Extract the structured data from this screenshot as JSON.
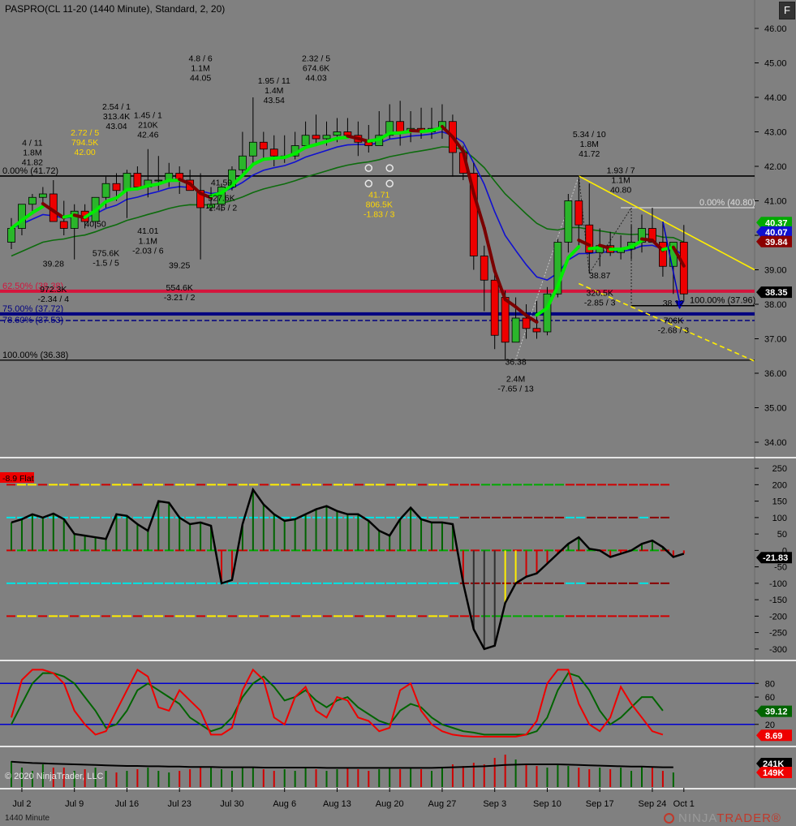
{
  "header": {
    "title": "PASPRO(CL 11-20 (1440 Minute), Standard, 2, 20)",
    "float_button": "F",
    "copyright": "© 2020 NinjaTrader, LLC",
    "timeframe": "1440 Minute",
    "brand_a": "NINJA",
    "brand_b": "TRADER",
    "brand_tm": "®"
  },
  "colors": {
    "background": "#808080",
    "up_candle": "#2bb52b",
    "down_candle": "#ee0000",
    "ema_fast": "#00ee00",
    "ema_blue": "#1010d0",
    "ema_green": "#0d6b0d",
    "ema_red": "#7a0000",
    "fib_red": "#d4143c",
    "fib_blue": "#000080",
    "trendline": "#ffee00",
    "separator": "#e6e6e6"
  },
  "chart_data": [
    {
      "type": "candlestick",
      "name": "price",
      "x": [
        "Jul 1",
        "Jul 2",
        "Jul 6",
        "Jul 7",
        "Jul 8",
        "Jul 9",
        "Jul 10",
        "Jul 13",
        "Jul 14",
        "Jul 15",
        "Jul 16",
        "Jul 17",
        "Jul 20",
        "Jul 21",
        "Jul 22",
        "Jul 23",
        "Jul 24",
        "Jul 27",
        "Jul 28",
        "Jul 29",
        "Jul 30",
        "Jul 31",
        "Aug 3",
        "Aug 4",
        "Aug 5",
        "Aug 6",
        "Aug 7",
        "Aug 10",
        "Aug 11",
        "Aug 12",
        "Aug 13",
        "Aug 14",
        "Aug 17",
        "Aug 18",
        "Aug 19",
        "Aug 20",
        "Aug 21",
        "Aug 24",
        "Aug 25",
        "Aug 26",
        "Aug 27",
        "Aug 28",
        "Aug 31",
        "Sep 1",
        "Sep 2",
        "Sep 3",
        "Sep 4",
        "Sep 8",
        "Sep 9",
        "Sep 10",
        "Sep 11",
        "Sep 14",
        "Sep 15",
        "Sep 16",
        "Sep 17",
        "Sep 18",
        "Sep 21",
        "Sep 22",
        "Sep 23",
        "Sep 24",
        "Sep 25",
        "Sep 28",
        "Sep 29",
        "Sep 30",
        "Oct 1"
      ],
      "open": [
        39.8,
        40.2,
        40.9,
        41.1,
        41.2,
        40.4,
        40.2,
        40.7,
        40.4,
        41.1,
        41.5,
        41.3,
        41.8,
        41.4,
        41.6,
        41.6,
        41.8,
        41.6,
        41.3,
        40.8,
        40.9,
        41.4,
        41.9,
        42.3,
        42.7,
        42.5,
        42.3,
        42.3,
        42.6,
        42.9,
        42.8,
        42.9,
        43.0,
        42.9,
        42.7,
        42.6,
        42.9,
        43.3,
        43.0,
        43.1,
        43.0,
        43.1,
        43.3,
        42.4,
        41.8,
        39.4,
        38.7,
        38.2,
        36.9,
        37.6,
        37.3,
        37.2,
        38.3,
        39.8,
        41.0,
        40.3,
        39.5,
        39.7,
        39.5,
        39.6,
        39.8,
        40.2,
        39.8,
        39.1,
        39.8
      ],
      "high": [
        40.5,
        40.7,
        41.2,
        41.4,
        41.6,
        41.0,
        40.9,
        40.9,
        41.1,
        41.7,
        41.8,
        41.9,
        42.0,
        42.5,
        42.3,
        42.1,
        42.0,
        41.9,
        41.8,
        41.4,
        41.5,
        42.0,
        43.0,
        44.0,
        43.0,
        42.9,
        42.9,
        43.0,
        43.3,
        43.5,
        43.3,
        43.4,
        43.4,
        43.3,
        43.2,
        43.6,
        43.8,
        43.9,
        43.6,
        43.7,
        43.7,
        43.8,
        43.5,
        42.6,
        42.1,
        39.7,
        38.9,
        38.4,
        38.2,
        38.0,
        38.1,
        38.5,
        39.9,
        41.2,
        41.7,
        41.5,
        40.2,
        40.1,
        40.0,
        40.3,
        40.6,
        40.8,
        40.4,
        39.4,
        40.3
      ],
      "low": [
        39.6,
        40.0,
        40.6,
        40.9,
        40.7,
        40.0,
        39.3,
        40.2,
        40.2,
        40.8,
        41.0,
        40.5,
        41.4,
        41.1,
        41.3,
        41.4,
        41.2,
        41.4,
        39.3,
        40.7,
        40.7,
        41.3,
        41.7,
        42.1,
        42.2,
        42.0,
        42.1,
        42.2,
        42.5,
        42.6,
        42.6,
        42.7,
        42.8,
        42.3,
        42.4,
        42.6,
        42.8,
        42.6,
        42.7,
        42.8,
        42.8,
        42.8,
        41.7,
        41.6,
        39.0,
        37.8,
        36.7,
        36.4,
        37.1,
        37.0,
        37.0,
        37.1,
        38.2,
        39.5,
        39.6,
        38.9,
        39.1,
        39.4,
        39.3,
        39.3,
        39.5,
        39.9,
        38.8,
        38.3,
        38.1
      ],
      "close": [
        40.2,
        40.9,
        41.1,
        41.2,
        40.4,
        40.2,
        40.7,
        40.4,
        41.1,
        41.5,
        41.3,
        41.8,
        41.4,
        41.6,
        41.6,
        41.8,
        41.6,
        41.3,
        40.8,
        40.9,
        41.4,
        41.9,
        42.3,
        42.7,
        42.5,
        42.3,
        42.3,
        42.6,
        42.9,
        42.8,
        42.9,
        43.0,
        42.9,
        42.7,
        42.6,
        42.9,
        43.3,
        43.0,
        43.1,
        43.0,
        43.1,
        43.3,
        42.4,
        41.8,
        39.4,
        38.7,
        37.1,
        36.9,
        37.6,
        37.3,
        37.2,
        38.3,
        39.8,
        41.0,
        40.3,
        39.5,
        39.7,
        39.5,
        39.6,
        39.8,
        40.2,
        39.8,
        39.1,
        39.8,
        38.3
      ],
      "y_ticks": [
        34.0,
        35.0,
        36.0,
        37.0,
        38.0,
        39.0,
        40.0,
        41.0,
        42.0,
        43.0,
        44.0,
        45.0,
        46.0
      ],
      "y_tick_labels": [
        "34.00",
        "35.00",
        "36.00",
        "37.00",
        "38.00",
        "39.00",
        "40.00",
        "41.00",
        "42.00",
        "43.00",
        "44.00",
        "45.00",
        "46.00"
      ],
      "ylim": [
        33.6,
        46.4
      ],
      "x_tick_labels": [
        "Jul 2",
        "Jul 9",
        "Jul 16",
        "Jul 23",
        "Jul 30",
        "Aug 6",
        "Aug 13",
        "Aug 20",
        "Aug 27",
        "Sep 3",
        "Sep 10",
        "Sep 17",
        "Sep 24",
        "Oct 1"
      ],
      "x_tick_index": [
        1,
        6,
        11,
        16,
        21,
        26,
        31,
        36,
        41,
        46,
        51,
        56,
        61,
        64
      ],
      "fib_levels": [
        {
          "label": "0.00% (41.72)",
          "value": 41.72,
          "color": "#000000"
        },
        {
          "label": "62.50% (38.38)",
          "value": 38.38,
          "color": "#d4143c"
        },
        {
          "label": "75.00% (37.72)",
          "value": 37.72,
          "color": "#000080"
        },
        {
          "label": "78.60% (37.53)",
          "value": 37.53,
          "color": "#000080"
        },
        {
          "label": "100.00% (36.38)",
          "value": 36.38,
          "color": "#000000"
        },
        {
          "label": "0.00% (40.80)",
          "value": 40.8,
          "color": "#c8c8c8"
        },
        {
          "label": "100.00% (37.96)",
          "value": 37.96,
          "color": "#000000"
        }
      ],
      "price_badges": [
        {
          "label": "40.37",
          "value": 40.37,
          "color": "#00aa00"
        },
        {
          "label": "40.07",
          "value": 40.07,
          "color": "#1010d0"
        },
        {
          "label": "39.84",
          "value": 39.84,
          "color": "#8b0000"
        },
        {
          "label": "38.35",
          "value": 38.35,
          "color": "#000000"
        }
      ],
      "swing_labels": [
        {
          "lines": [
            "4 / 11",
            "1.8M",
            "41.82"
          ],
          "i": 2,
          "y": 42.6,
          "color": "#000000"
        },
        {
          "lines": [
            "2.72 / 5",
            "794.5K",
            "42.00"
          ],
          "i": 7,
          "y": 42.9,
          "color": "#ffd700"
        },
        {
          "lines": [
            "2.54 / 1",
            "313.4K",
            "43.04"
          ],
          "i": 10,
          "y": 43.65,
          "color": "#000000"
        },
        {
          "lines": [
            "1.45 / 1",
            "210K",
            "42.46"
          ],
          "i": 13,
          "y": 43.4,
          "color": "#000000"
        },
        {
          "lines": [
            "4.8 / 6",
            "1.1M",
            "44.05"
          ],
          "i": 18,
          "y": 45.05,
          "color": "#000000"
        },
        {
          "lines": [
            "1.95 / 11",
            "1.4M",
            "43.54"
          ],
          "i": 25,
          "y": 44.4,
          "color": "#000000"
        },
        {
          "lines": [
            "2.32 / 5",
            "674.6K",
            "44.03"
          ],
          "i": 29,
          "y": 45.05,
          "color": "#000000"
        },
        {
          "lines": [
            "5.34 / 10",
            "1.8M",
            "41.72"
          ],
          "i": 55,
          "y": 42.85,
          "color": "#000000"
        },
        {
          "lines": [
            "1.93 / 7",
            "1.1M",
            "40.80"
          ],
          "i": 58,
          "y": 41.8,
          "color": "#000000"
        },
        {
          "lines": [
            "41.71",
            "806.5K",
            "-1.83 / 3"
          ],
          "i": 35,
          "y": 41.1,
          "color": "#ffd700"
        },
        {
          "lines": [
            "40.50"
          ],
          "i": 8,
          "y": 40.25,
          "color": "#000000"
        },
        {
          "lines": [
            "575.6K",
            "-1.5 / 5"
          ],
          "i": 9,
          "y": 39.4,
          "color": "#000000"
        },
        {
          "lines": [
            "39.28"
          ],
          "i": 4,
          "y": 39.1,
          "color": "#000000"
        },
        {
          "lines": [
            "972.3K",
            "-2.34 / 4"
          ],
          "i": 4,
          "y": 38.35,
          "color": "#000000"
        },
        {
          "lines": [
            "41.01"
          ],
          "i": 13,
          "y": 40.05,
          "color": "#000000"
        },
        {
          "lines": [
            "1.1M",
            "-2.03 / 6"
          ],
          "i": 13,
          "y": 39.75,
          "color": "#000000"
        },
        {
          "lines": [
            "39.25"
          ],
          "i": 16,
          "y": 39.05,
          "color": "#000000"
        },
        {
          "lines": [
            "554.6K",
            "-3.21 / 2"
          ],
          "i": 16,
          "y": 38.4,
          "color": "#000000"
        },
        {
          "lines": [
            "41.59"
          ],
          "i": 20,
          "y": 41.45,
          "color": "#000000"
        },
        {
          "lines": [
            "527.6K",
            "-2.46 / 2"
          ],
          "i": 20,
          "y": 41.0,
          "color": "#000000"
        },
        {
          "lines": [
            "38.87"
          ],
          "i": 56,
          "y": 38.75,
          "color": "#000000"
        },
        {
          "lines": [
            "320.5K",
            "-2.85 / 3"
          ],
          "i": 56,
          "y": 38.25,
          "color": "#000000"
        },
        {
          "lines": [
            "36.38"
          ],
          "i": 48,
          "y": 36.25,
          "color": "#000000"
        },
        {
          "lines": [
            "2.4M",
            "-7.65 / 13"
          ],
          "i": 48,
          "y": 35.75,
          "color": "#000000"
        },
        {
          "lines": [
            "38.12"
          ],
          "i": 63,
          "y": 37.95,
          "color": "#000000"
        },
        {
          "lines": [
            "706K",
            "-2.68 / 3"
          ],
          "i": 63,
          "y": 37.45,
          "color": "#000000"
        }
      ]
    },
    {
      "type": "line",
      "name": "oscillator",
      "y_ticks": [
        250,
        200,
        150,
        100,
        50,
        0,
        -50,
        -100,
        -150,
        -200,
        -250,
        -300
      ],
      "ylim": [
        -330,
        275
      ],
      "levels": [
        200,
        100,
        0,
        -100,
        -200
      ],
      "status_label": "-8.9 Flat",
      "current_label": "-21.83",
      "values": [
        85,
        95,
        110,
        100,
        112,
        95,
        50,
        45,
        40,
        35,
        110,
        105,
        80,
        60,
        150,
        145,
        100,
        80,
        85,
        75,
        -100,
        -90,
        80,
        185,
        140,
        110,
        90,
        95,
        110,
        125,
        135,
        120,
        110,
        110,
        90,
        60,
        45,
        95,
        130,
        95,
        85,
        85,
        80,
        -100,
        -240,
        -300,
        -290,
        -160,
        -100,
        -80,
        -70,
        -40,
        -10,
        20,
        40,
        5,
        0,
        -20,
        -10,
        0,
        20,
        30,
        10,
        -20,
        -10,
        -5
      ]
    },
    {
      "type": "line",
      "name": "stochastic",
      "y_ticks": [
        80,
        60,
        40,
        20
      ],
      "ylim": [
        -10,
        110
      ],
      "levels": [
        80,
        20
      ],
      "series": [
        {
          "name": "%D",
          "color": "#006400",
          "current_label": "39.12",
          "values": [
            20,
            50,
            80,
            95,
            95,
            90,
            80,
            60,
            40,
            15,
            20,
            40,
            70,
            80,
            70,
            60,
            50,
            30,
            20,
            10,
            15,
            30,
            60,
            80,
            90,
            75,
            55,
            60,
            70,
            55,
            45,
            55,
            60,
            45,
            35,
            25,
            20,
            40,
            50,
            45,
            30,
            20,
            15,
            10,
            8,
            5,
            5,
            5,
            5,
            5,
            10,
            30,
            70,
            95,
            90,
            70,
            40,
            20,
            30,
            45,
            60,
            60,
            40
          ]
        },
        {
          "name": "%K",
          "color": "#ee0000",
          "current_label": "8.69",
          "values": [
            30,
            85,
            100,
            100,
            95,
            80,
            40,
            20,
            5,
            10,
            40,
            70,
            100,
            90,
            45,
            40,
            70,
            55,
            40,
            5,
            5,
            15,
            70,
            100,
            85,
            30,
            20,
            60,
            75,
            40,
            30,
            60,
            55,
            30,
            25,
            10,
            15,
            70,
            80,
            40,
            20,
            10,
            5,
            3,
            2,
            2,
            2,
            2,
            2,
            5,
            25,
            80,
            100,
            100,
            50,
            20,
            10,
            30,
            75,
            50,
            30,
            10,
            5
          ]
        }
      ]
    },
    {
      "type": "bar",
      "name": "volume",
      "current_label_avg": "241K",
      "current_label_vol": "149K",
      "values": [
        0.8,
        0.6,
        0.5,
        0.7,
        0.6,
        0.6,
        0.5,
        0.55,
        0.6,
        0.5,
        0.45,
        0.5,
        0.55,
        0.6,
        0.5,
        0.45,
        0.5,
        0.55,
        0.6,
        0.6,
        0.55,
        0.5,
        0.6,
        0.6,
        0.55,
        0.5,
        0.55,
        0.5,
        0.6,
        0.55,
        0.5,
        0.55,
        0.6,
        0.55,
        0.5,
        0.55,
        0.6,
        0.55,
        0.6,
        0.55,
        0.5,
        0.6,
        0.7,
        0.65,
        0.75,
        0.7,
        0.9,
        1.0,
        0.85,
        0.7,
        0.65,
        0.6,
        0.7,
        0.65,
        0.6,
        0.55,
        0.6,
        0.55,
        0.6,
        0.5,
        0.65,
        0.6,
        0.5,
        0.45
      ],
      "avg": [
        0.78,
        0.76,
        0.74,
        0.73,
        0.72,
        0.71,
        0.7,
        0.69,
        0.68,
        0.67,
        0.66,
        0.65,
        0.65,
        0.64,
        0.64,
        0.63,
        0.63,
        0.62,
        0.62,
        0.62,
        0.61,
        0.61,
        0.61,
        0.61,
        0.6,
        0.6,
        0.6,
        0.6,
        0.6,
        0.6,
        0.59,
        0.59,
        0.59,
        0.59,
        0.59,
        0.59,
        0.59,
        0.59,
        0.59,
        0.59,
        0.59,
        0.6,
        0.61,
        0.62,
        0.63,
        0.64,
        0.66,
        0.68,
        0.69,
        0.7,
        0.7,
        0.7,
        0.7,
        0.69,
        0.68,
        0.67,
        0.66,
        0.65,
        0.64,
        0.63,
        0.63,
        0.62,
        0.61,
        0.61
      ]
    }
  ]
}
